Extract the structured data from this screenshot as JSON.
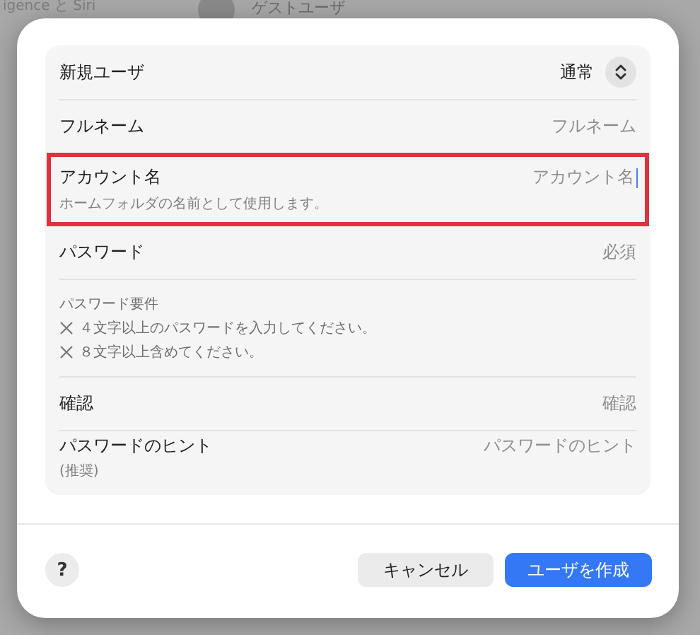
{
  "background": {
    "sidebar_item": "igence と Siri",
    "list_item": "ゲストユーザ"
  },
  "dialog": {
    "rows": [
      {
        "kind": "popup",
        "label": "新規ユーザ",
        "value": "通常"
      },
      {
        "kind": "field",
        "label": "フルネーム",
        "placeholder": "フルネーム",
        "highlighted": false,
        "focused": false
      },
      {
        "kind": "field",
        "label": "アカウント名",
        "placeholder": "アカウント名",
        "caption": "ホームフォルダの名前として使用します。",
        "highlighted": true,
        "focused": true
      },
      {
        "kind": "field",
        "label": "パスワード",
        "placeholder": "必須",
        "highlighted": false,
        "focused": false
      },
      {
        "kind": "requirements",
        "title": "パスワード要件",
        "items": [
          {
            "text": "４文字以上のパスワードを入力してください。",
            "met": false
          },
          {
            "text": "８文字以上含めてください。",
            "met": false
          }
        ]
      },
      {
        "kind": "field",
        "label": "確認",
        "placeholder": "確認",
        "highlighted": false,
        "focused": false
      },
      {
        "kind": "field",
        "label": "パスワードのヒント",
        "caption": "(推奨)",
        "placeholder": "パスワードのヒント",
        "highlighted": false,
        "focused": false
      }
    ],
    "help": "?",
    "buttons": [
      {
        "label": "キャンセル",
        "kind": "secondary"
      },
      {
        "label": "ユーザを作成",
        "kind": "primary"
      }
    ]
  }
}
